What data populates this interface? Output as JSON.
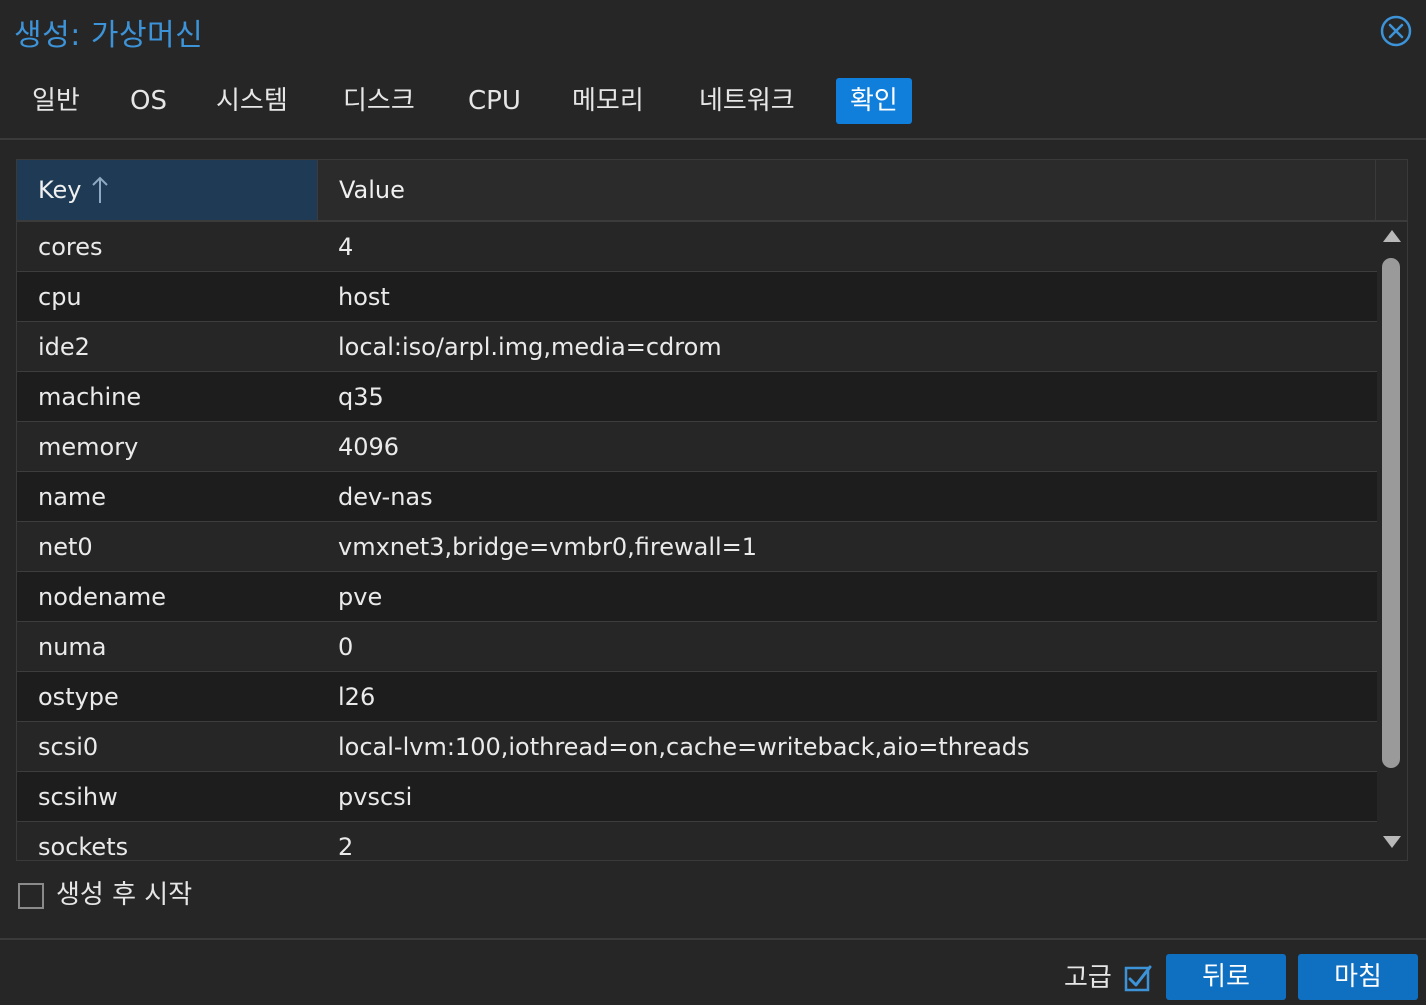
{
  "window": {
    "title": "생성: 가상머신"
  },
  "tabs": [
    {
      "label": "일반"
    },
    {
      "label": "OS"
    },
    {
      "label": "시스템"
    },
    {
      "label": "디스크"
    },
    {
      "label": "CPU"
    },
    {
      "label": "메모리"
    },
    {
      "label": "네트워크"
    },
    {
      "label": "확인",
      "active": true
    }
  ],
  "grid": {
    "columns": {
      "key": "Key",
      "value": "Value"
    },
    "sort": {
      "column": "Key",
      "direction": "ascending"
    },
    "rows": [
      {
        "key": "cores",
        "value": "4"
      },
      {
        "key": "cpu",
        "value": "host"
      },
      {
        "key": "ide2",
        "value": "local:iso/arpl.img,media=cdrom"
      },
      {
        "key": "machine",
        "value": "q35"
      },
      {
        "key": "memory",
        "value": "4096"
      },
      {
        "key": "name",
        "value": "dev-nas"
      },
      {
        "key": "net0",
        "value": "vmxnet3,bridge=vmbr0,firewall=1"
      },
      {
        "key": "nodename",
        "value": "pve"
      },
      {
        "key": "numa",
        "value": "0"
      },
      {
        "key": "ostype",
        "value": "l26"
      },
      {
        "key": "scsi0",
        "value": "local-lvm:100,iothread=on,cache=writeback,aio=threads"
      },
      {
        "key": "scsihw",
        "value": "pvscsi"
      },
      {
        "key": "sockets",
        "value": "2"
      }
    ]
  },
  "options": {
    "start_after_created": {
      "label": "생성 후 시작",
      "checked": false
    }
  },
  "footer": {
    "advanced": {
      "label": "고급",
      "checked": true
    },
    "back_label": "뒤로",
    "finish_label": "마침"
  },
  "colors": {
    "accent": "#0f7fdb",
    "title": "#3d93d8",
    "button": "#0f6fc0",
    "background": "#262626"
  }
}
